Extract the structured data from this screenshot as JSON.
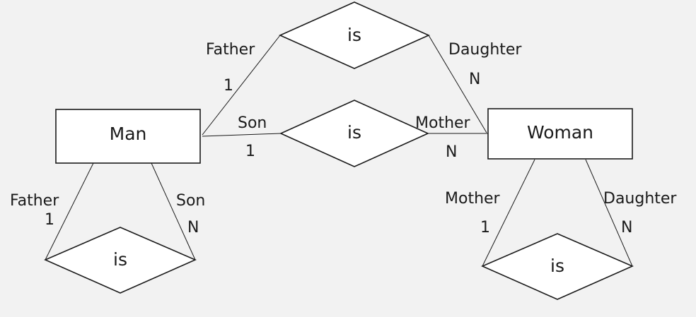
{
  "colors": {
    "background": "#f2f2f2",
    "stroke": "#1a1a1a",
    "fill": "#ffffff"
  },
  "entities": {
    "man": "Man",
    "woman": "Woman"
  },
  "relationships": {
    "top": "is",
    "middle": "is",
    "bottom_left": "is",
    "bottom_right": "is"
  },
  "roles": {
    "top_father": "Father",
    "top_daughter": "Daughter",
    "mid_son": "Son",
    "mid_mother": "Mother",
    "left_father": "Father",
    "left_son": "Son",
    "right_mother": "Mother",
    "right_daughter": "Daughter"
  },
  "cardinalities": {
    "top_father": "1",
    "top_daughter": "N",
    "mid_son": "1",
    "mid_mother": "N",
    "left_father": "1",
    "left_son": "N",
    "right_mother": "1",
    "right_daughter": "N"
  }
}
